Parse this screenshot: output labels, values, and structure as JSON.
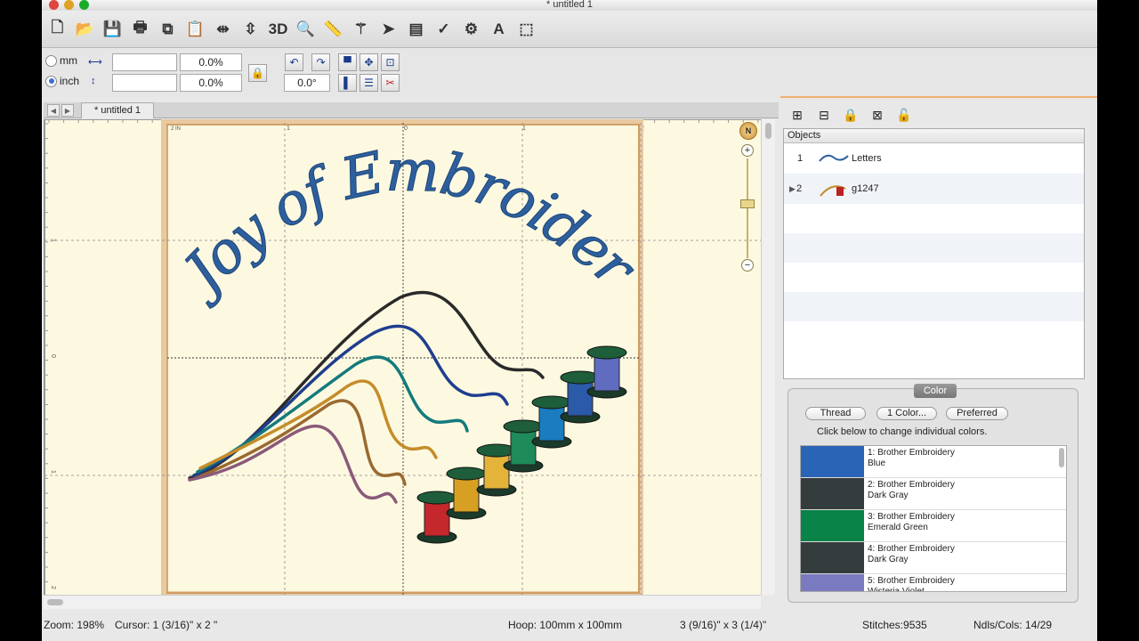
{
  "window": {
    "title": "* untitled 1"
  },
  "toolbar": {
    "items": [
      {
        "name": "new-icon",
        "glyph": "🗋"
      },
      {
        "name": "open-icon",
        "glyph": "📂"
      },
      {
        "name": "save-icon",
        "glyph": "💾"
      },
      {
        "name": "print-icon",
        "glyph": "🖶"
      },
      {
        "name": "copy-icon",
        "glyph": "⧉"
      },
      {
        "name": "paste-icon",
        "glyph": "📋"
      },
      {
        "name": "flip-horizontal-icon",
        "glyph": "⇹"
      },
      {
        "name": "flip-vertical-icon",
        "glyph": "⇳"
      },
      {
        "name": "3d-view-icon",
        "glyph": "3D"
      },
      {
        "name": "zoom-icon",
        "glyph": "🔍"
      },
      {
        "name": "measure-icon",
        "glyph": "📏"
      },
      {
        "name": "stitch-icon",
        "glyph": "⚚"
      },
      {
        "name": "select-pointer-icon",
        "glyph": "➤"
      },
      {
        "name": "properties-icon",
        "glyph": "▤"
      },
      {
        "name": "spell-check-icon",
        "glyph": "✓"
      },
      {
        "name": "settings-icon",
        "glyph": "⚙"
      },
      {
        "name": "text-icon",
        "glyph": "A"
      },
      {
        "name": "screen-icon",
        "glyph": "⬚"
      }
    ]
  },
  "props": {
    "unit_mm": "mm",
    "unit_inch": "inch",
    "width_value": "",
    "height_value": "",
    "width_percent": "0.0%",
    "height_percent": "0.0%",
    "rotation": "0.0°"
  },
  "canvas": {
    "tab_label": "* untitled 1",
    "ruler_top": [
      "2 IN",
      "1",
      "0",
      "1",
      "2"
    ],
    "ruler_left": [
      "1",
      "0",
      "1",
      "2"
    ],
    "design_text": "Joy of Embroidery"
  },
  "objects": {
    "header": "Objects",
    "rows": [
      {
        "num": "1",
        "label": "Letters",
        "expand": ""
      },
      {
        "num": "2",
        "label": "g1247",
        "expand": "▶"
      }
    ]
  },
  "color_panel": {
    "tab": "Color",
    "thread_button": "Thread",
    "onecolor_button": "1 Color...",
    "preferred_button": "Preferred",
    "hint": "Click below to change individual colors.",
    "swatches": [
      {
        "line1": "1: Brother Embroidery",
        "line2": "Blue",
        "color": "#2a64b6"
      },
      {
        "line1": "2: Brother Embroidery",
        "line2": "Dark Gray",
        "color": "#353c3e"
      },
      {
        "line1": "3: Brother Embroidery",
        "line2": "Emerald Green",
        "color": "#0a8348"
      },
      {
        "line1": "4: Brother Embroidery",
        "line2": "Dark Gray",
        "color": "#353c3e"
      },
      {
        "line1": "5: Brother Embroidery",
        "line2": "Wisteria Violet",
        "color": "#7a7ac0"
      }
    ]
  },
  "status": {
    "zoom": "Zoom: 198%",
    "cursor": "Cursor: 1 (3/16)\" x 2 \"",
    "hoop": "Hoop: 100mm x 100mm",
    "size": "3 (9/16)\" x 3 (1/4)\"",
    "stitches": "Stitches:9535",
    "ndls": "Ndls/Cols: 14/29"
  }
}
